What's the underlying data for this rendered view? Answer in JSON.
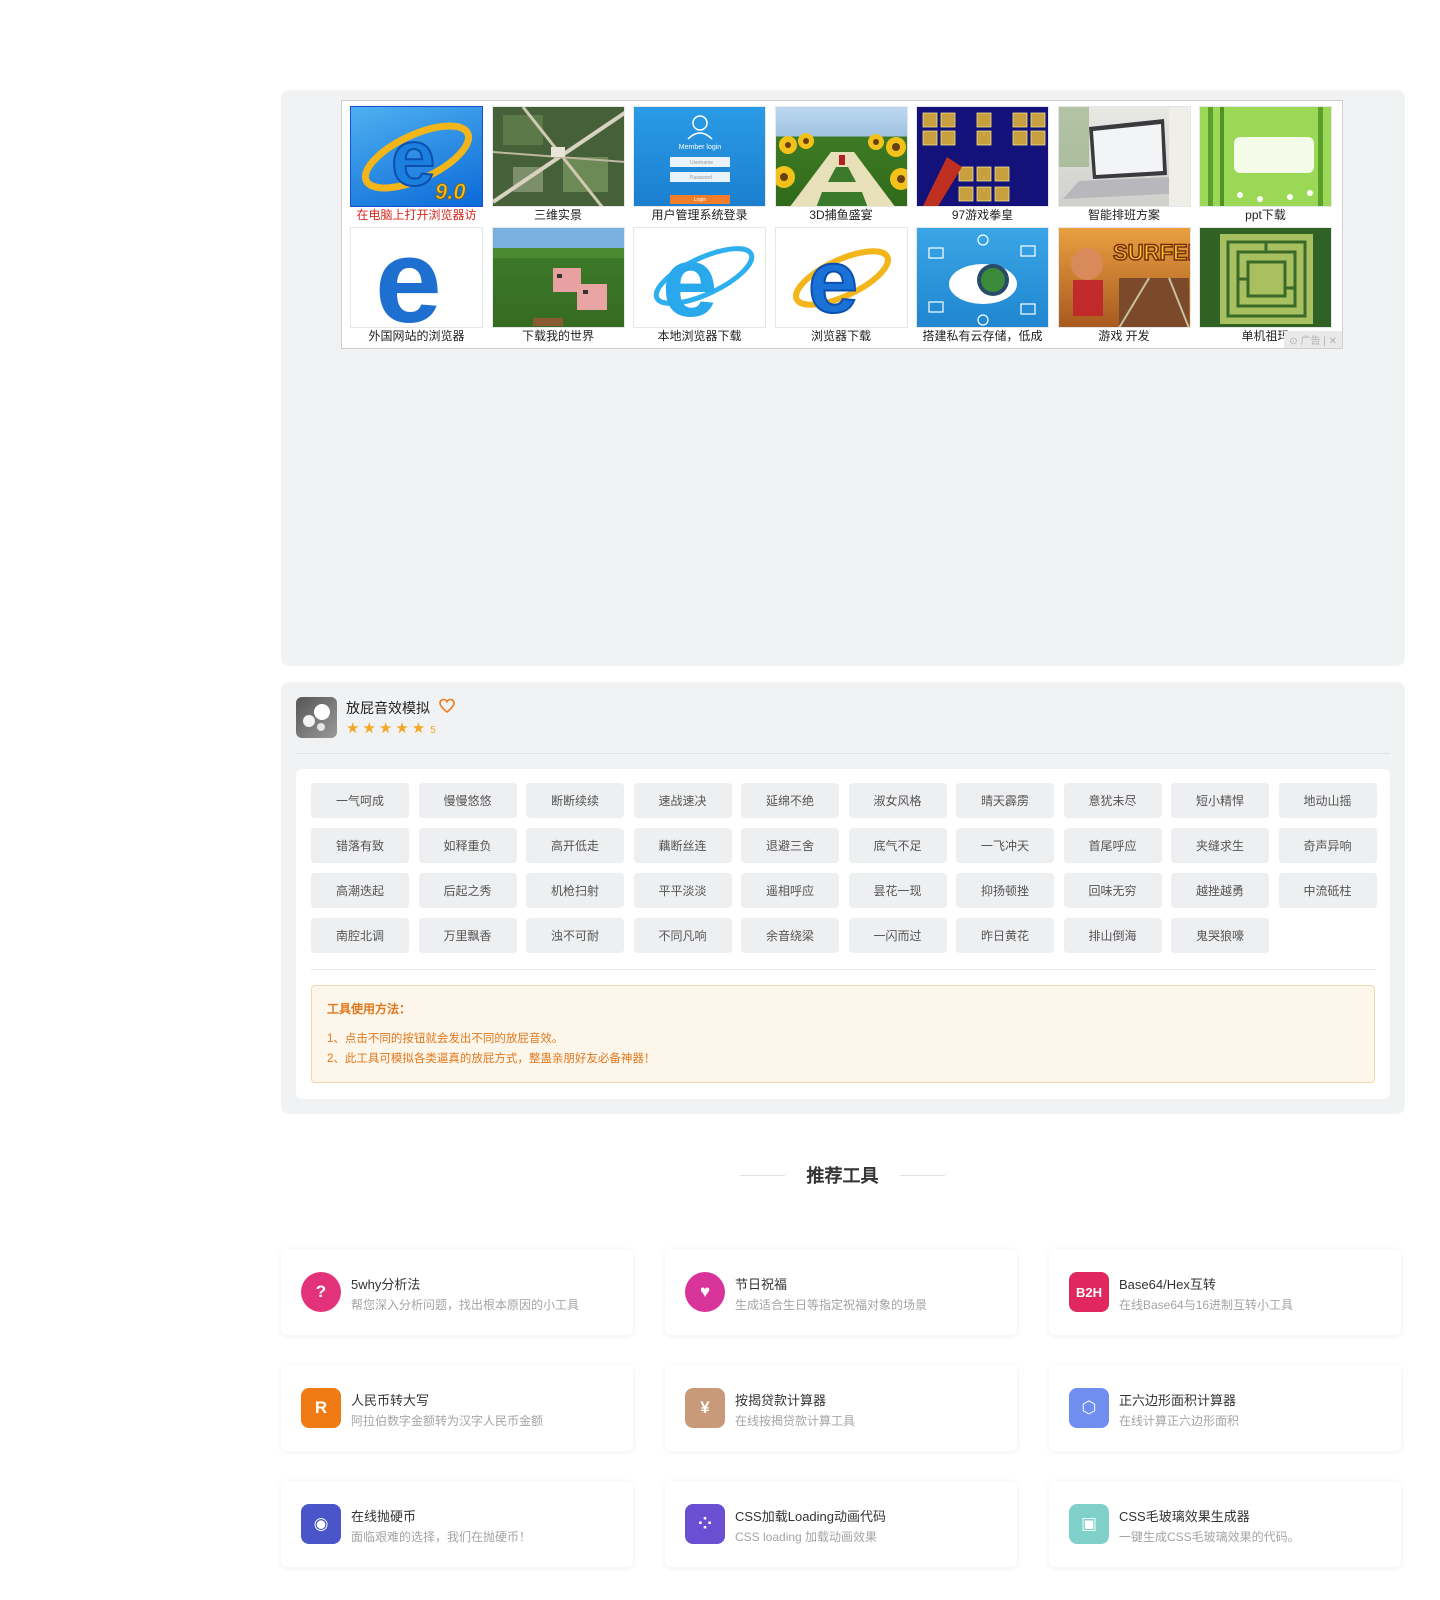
{
  "ads": {
    "items": [
      {
        "caption": "在电脑上打开浏览器访",
        "thumb": "ie9-logo",
        "red": true
      },
      {
        "caption": "三维实景",
        "thumb": "aerial-map"
      },
      {
        "caption": "用户管理系统登录",
        "thumb": "member-login"
      },
      {
        "caption": "3D捕鱼盛宴",
        "thumb": "sunflower-field"
      },
      {
        "caption": "97游戏拳皇",
        "thumb": "fighter-select"
      },
      {
        "caption": "智能排班方案",
        "thumb": "laptop"
      },
      {
        "caption": "ppt下载",
        "thumb": "bamboo-frame"
      },
      {
        "caption": "外国网站的浏览器",
        "thumb": "edge-blue-e"
      },
      {
        "caption": "下载我的世界",
        "thumb": "minecraft-pig"
      },
      {
        "caption": "本地浏览器下载",
        "thumb": "ie-cyan"
      },
      {
        "caption": "浏览器下载",
        "thumb": "ie-classic"
      },
      {
        "caption": "搭建私有云存储，低成",
        "thumb": "cloud-network"
      },
      {
        "caption": "游戏 开发",
        "thumb": "subway-surfers"
      },
      {
        "caption": "单机祖玛",
        "thumb": "maze"
      }
    ],
    "login_text": {
      "title": "Member login",
      "user": "Username",
      "pass": "Password",
      "btn": "Login"
    },
    "ie_version": "9.0",
    "subway_text": "SURFERS",
    "ad_mark": "⊙ 广告 | ✕"
  },
  "tool": {
    "title": "放屁音效模拟",
    "rating_stars": 5,
    "rating_text": "5",
    "star_glyphs": "★★★★★",
    "buttons": [
      "一气呵成",
      "慢慢悠悠",
      "断断续续",
      "速战速决",
      "延绵不绝",
      "淑女风格",
      "晴天霹雳",
      "意犹未尽",
      "短小精悍",
      "地动山摇",
      "错落有致",
      "如释重负",
      "高开低走",
      "藕断丝连",
      "退避三舍",
      "底气不足",
      "一飞冲天",
      "首尾呼应",
      "夹缝求生",
      "奇声异响",
      "高潮迭起",
      "后起之秀",
      "机枪扫射",
      "平平淡淡",
      "遥相呼应",
      "昙花一现",
      "抑扬顿挫",
      "回味无穷",
      "越挫越勇",
      "中流砥柱",
      "南腔北调",
      "万里飘香",
      "浊不可耐",
      "不同凡响",
      "余音绕梁",
      "一闪而过",
      "昨日黄花",
      "排山倒海",
      "鬼哭狼嚎"
    ],
    "usage": {
      "title": "工具使用方法：",
      "lines": [
        "1、点击不同的按钮就会发出不同的放屁音效。",
        "2、此工具可模拟各类逼真的放屁方式，整蛊亲朋好友必备神器！"
      ]
    }
  },
  "recommend": {
    "title": "推荐工具",
    "items": [
      {
        "name": "5why分析法",
        "desc": "帮您深入分析问题，找出根本原因的小工具",
        "icon": "question-icon",
        "glyph": "?",
        "color": "#e2337a"
      },
      {
        "name": "节日祝福",
        "desc": "生成适合生日等指定祝福对象的场景",
        "icon": "heart-gift-icon",
        "glyph": "♥",
        "color": "#d8349a"
      },
      {
        "name": "Base64/Hex互转",
        "desc": "在线Base64与16进制互转小工具",
        "icon": "b2h-icon",
        "glyph": "B2H",
        "color": "#e0285e"
      },
      {
        "name": "人民币转大写",
        "desc": "阿拉伯数字金额转为汉字人民币金额",
        "icon": "rmb-r-icon",
        "glyph": "R",
        "color": "#f07a14"
      },
      {
        "name": "按揭贷款计算器",
        "desc": "在线按揭贷款计算工具",
        "icon": "money-bag-icon",
        "glyph": "¥",
        "color": "#c99a7a"
      },
      {
        "name": "正六边形面积计算器",
        "desc": "在线计算正六边形面积",
        "icon": "hexagon-icon",
        "glyph": "⬡",
        "color": "#6f8ef0"
      },
      {
        "name": "在线抛硬币",
        "desc": "面临艰难的选择，我们在抛硬币！",
        "icon": "coin-icon",
        "glyph": "◉",
        "color": "#4a55c9"
      },
      {
        "name": "CSS加载Loading动画代码",
        "desc": "CSS loading 加载动画效果",
        "icon": "loading-dots-icon",
        "glyph": "⁘",
        "color": "#6a4fd3"
      },
      {
        "name": "CSS毛玻璃效果生成器",
        "desc": "一键生成CSS毛玻璃效果的代码。",
        "icon": "glass-icon",
        "glyph": "▣",
        "color": "#7fd0c8"
      }
    ]
  }
}
